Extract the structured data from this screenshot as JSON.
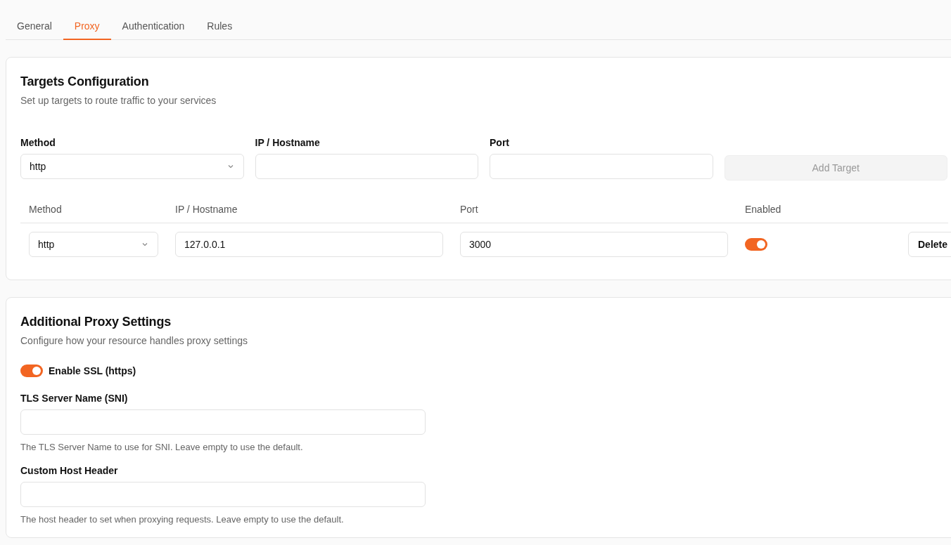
{
  "tabs": [
    {
      "label": "General",
      "selected": false
    },
    {
      "label": "Proxy",
      "selected": true
    },
    {
      "label": "Authentication",
      "selected": false
    },
    {
      "label": "Rules",
      "selected": false
    }
  ],
  "targets_configuration": {
    "title": "Targets Configuration",
    "subtitle": "Set up targets to route traffic to your services",
    "form": {
      "fields": [
        {
          "label": "Method",
          "kind": "select",
          "value": "http"
        },
        {
          "label": "IP / Hostname",
          "kind": "text"
        },
        {
          "label": "Port",
          "kind": "text"
        }
      ],
      "add_button": {
        "label": "Add Target",
        "disabled": true
      }
    },
    "table": {
      "columns": [
        "Method",
        "IP / Hostname",
        "Port",
        "Enabled"
      ],
      "rows": [
        {
          "method": "http",
          "ip": "127.0.0.1",
          "port": "3000",
          "enabled": true,
          "action": "Delete"
        }
      ]
    }
  },
  "additional_proxy_settings": {
    "title": "Additional Proxy Settings",
    "subtitle": "Configure how your resource handles proxy settings",
    "ssl_toggle": {
      "label": "Enable SSL (https)",
      "on": true
    },
    "fields": [
      {
        "label": "TLS Server Name (SNI)",
        "help": "The TLS Server Name to use for SNI. Leave empty to use the default."
      },
      {
        "label": "Custom Host Header",
        "help": "The host header to set when proxying requests. Leave empty to use the default."
      }
    ]
  }
}
